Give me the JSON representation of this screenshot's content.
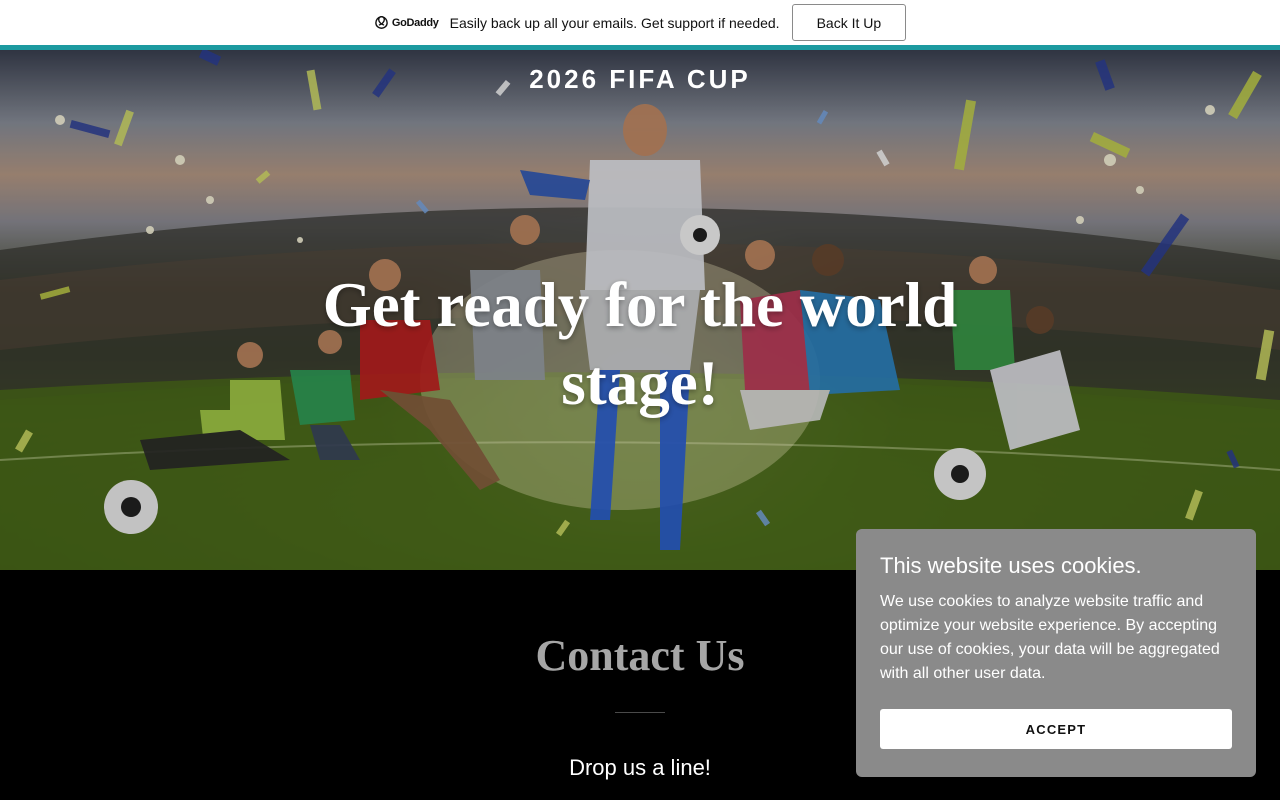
{
  "promo_bar": {
    "brand_name": "GoDaddy",
    "brand_icon": "godaddy-logo-icon",
    "message": "Easily back up all your emails. Get support if needed.",
    "button_label": "Back It Up",
    "accent_color": "#1c9aa0"
  },
  "hero": {
    "site_title": "2026 FIFA CUP",
    "headline": "Get ready for the world stage!",
    "image": "soccer-players-stadium-photo"
  },
  "contact": {
    "title": "Contact Us",
    "subtitle": "Drop us a line!"
  },
  "cookie_banner": {
    "title": "This website uses cookies.",
    "body": "We use cookies to analyze website traffic and optimize your website experience. By accepting our use of cookies, your data will be aggregated with all other user data.",
    "accept_label": "ACCEPT",
    "background_color": "#8a8a8a"
  }
}
